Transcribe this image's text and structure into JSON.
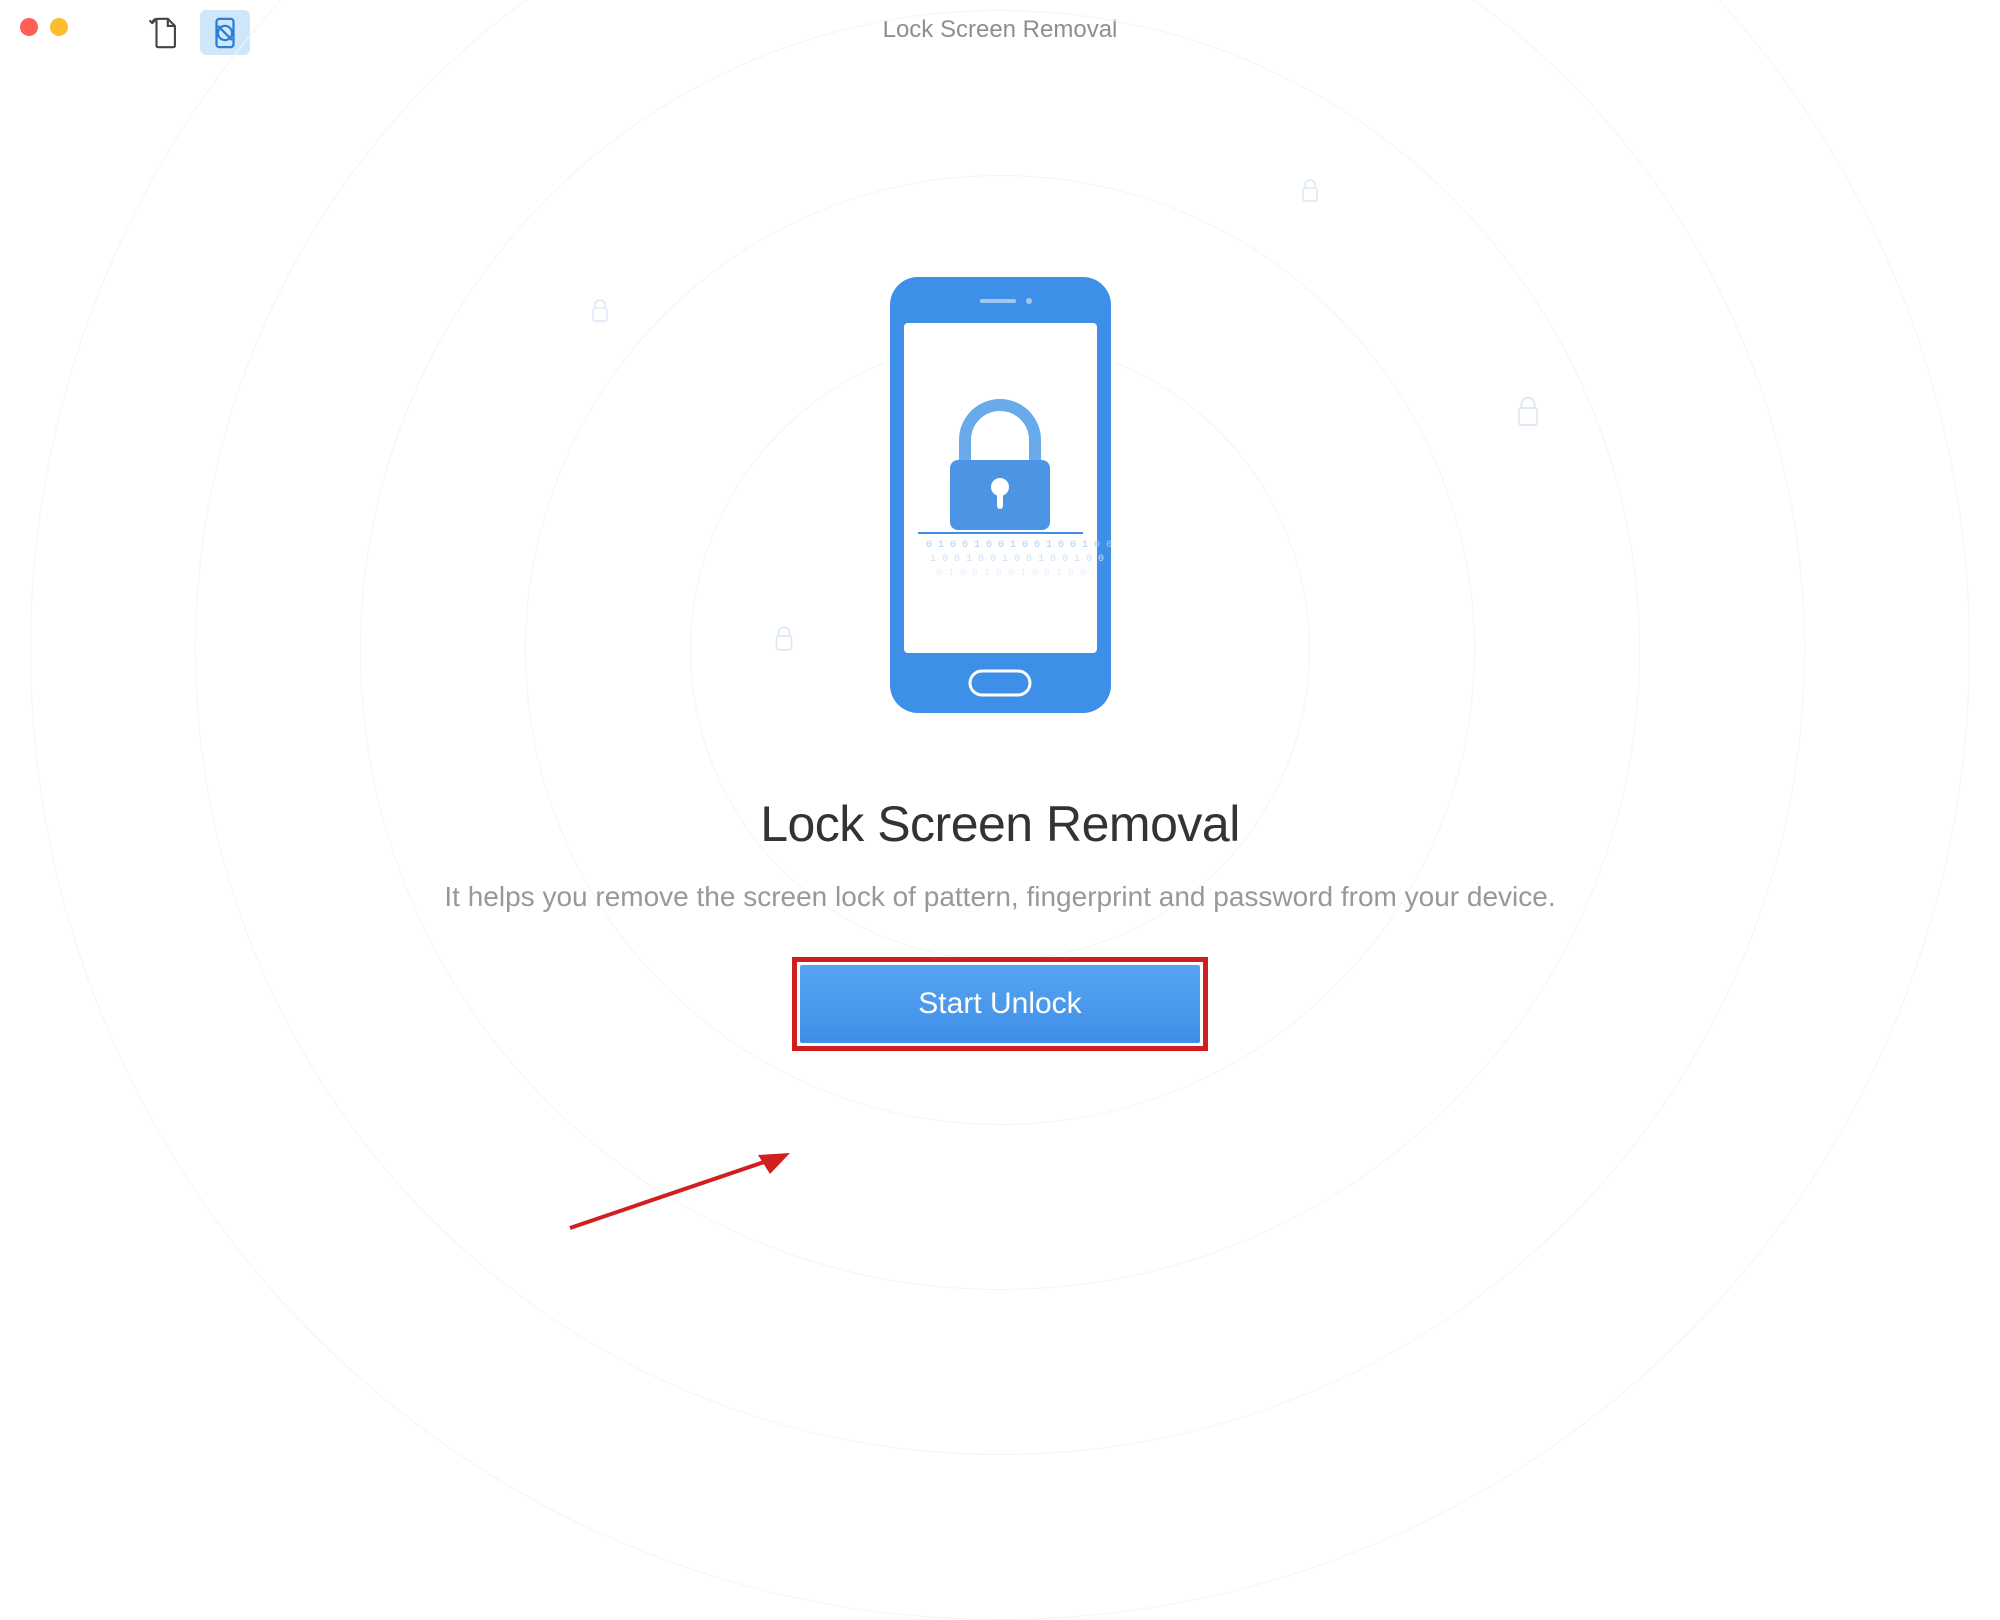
{
  "titlebar": {
    "window_title": "Lock Screen Removal"
  },
  "toolbar": {
    "restore_icon_name": "restore-document-icon",
    "unlock_icon_name": "unlock-phone-icon"
  },
  "main": {
    "heading": "Lock Screen Removal",
    "description": "It helps you remove the screen lock of pattern, fingerprint and password from your device.",
    "primary_button_label": "Start Unlock"
  },
  "colors": {
    "accent": "#3e8fe8",
    "annotation": "#cf1f1f"
  }
}
